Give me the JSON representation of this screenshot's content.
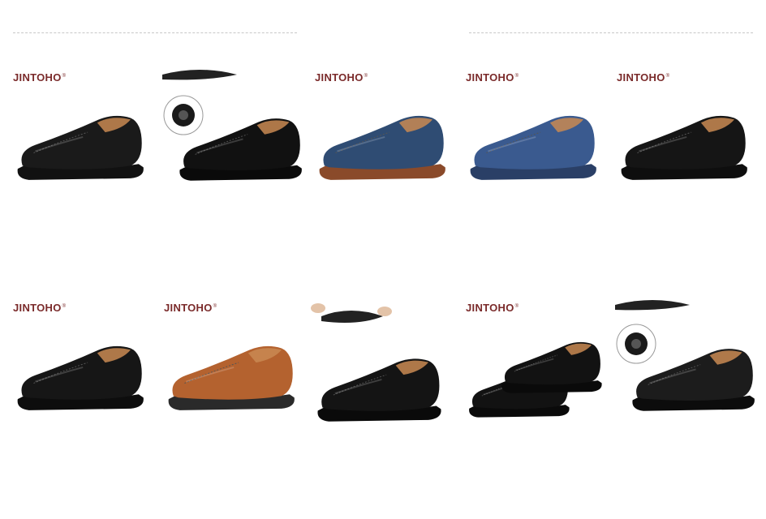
{
  "brand_mark": "®",
  "products": [
    {
      "brand": "JINTOHO",
      "shoe": "black-textured-slip-on-shoe",
      "color": "#1a1a1a",
      "sole": "#111111",
      "extras": "none"
    },
    {
      "brand": "",
      "shoe": "black-leather-loafer-with-sole-detail",
      "color": "#111111",
      "sole": "#0a0a0a",
      "extras": "sole-inset"
    },
    {
      "brand": "JINTOHO",
      "shoe": "navy-driving-loafer",
      "color": "#2f4c73",
      "sole": "#8a4a2a",
      "extras": "none"
    },
    {
      "brand": "JINTOHO",
      "shoe": "blue-driving-loafer",
      "color": "#3a5a8f",
      "sole": "#2a3f66",
      "extras": "none"
    },
    {
      "brand": "JINTOHO",
      "shoe": "black-driving-loafer",
      "color": "#151515",
      "sole": "#0e0e0e",
      "extras": "none"
    },
    {
      "brand": "JINTOHO",
      "shoe": "black-moc-toe-loafer",
      "color": "#161616",
      "sole": "#0d0d0d",
      "extras": "none"
    },
    {
      "brand": "JINTOHO",
      "shoe": "brown-leather-loafer",
      "color": "#b4622f",
      "sole": "#2a2a2a",
      "extras": "none"
    },
    {
      "brand": "",
      "shoe": "black-perforated-driving-loafer",
      "color": "#141414",
      "sole": "#0a0a0a",
      "extras": "hands-bending"
    },
    {
      "brand": "JINTOHO",
      "shoe": "black-loafer-pair",
      "color": "#121212",
      "sole": "#0a0a0a",
      "extras": "pair"
    },
    {
      "brand": "",
      "shoe": "black-loafer-with-sole-inset",
      "color": "#1c1c1c",
      "sole": "#0c0c0c",
      "extras": "sole-inset-hands"
    }
  ]
}
